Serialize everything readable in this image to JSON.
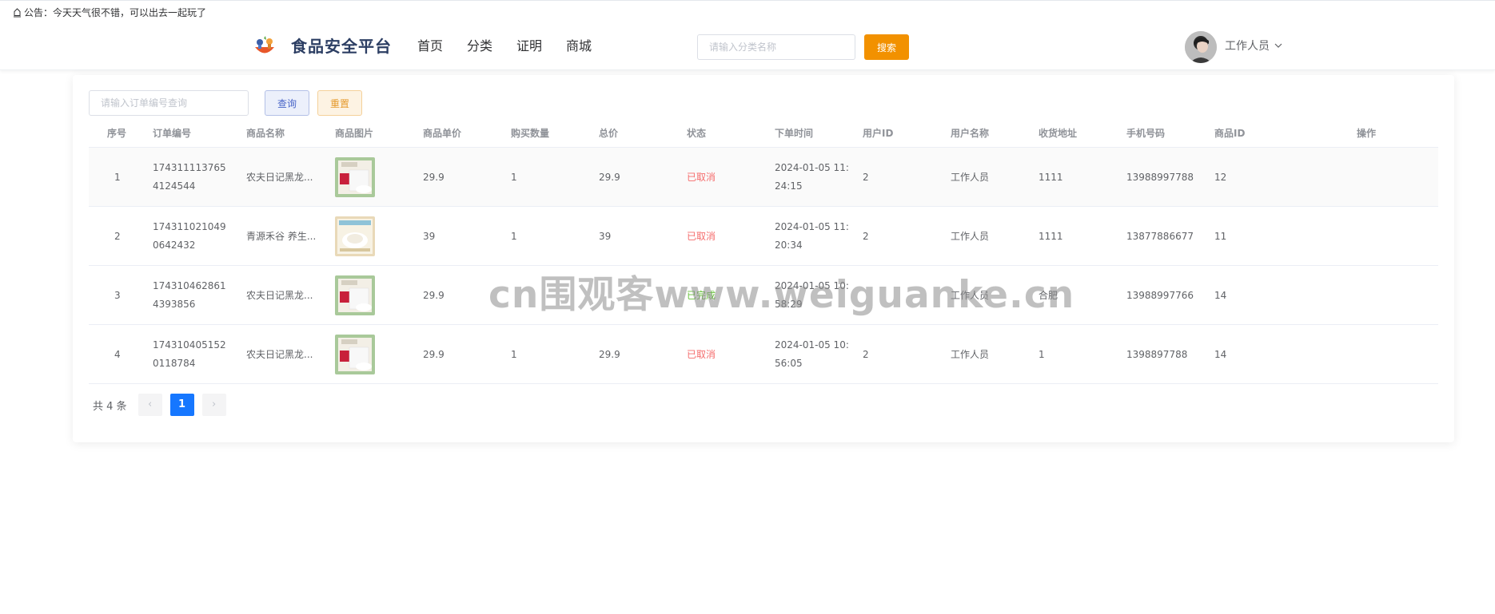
{
  "notice": {
    "text": "公告：今天天气很不错，可以出去一起玩了",
    "icon": "bell-icon"
  },
  "header": {
    "site_title": "食品安全平台",
    "nav": [
      "首页",
      "分类",
      "证明",
      "商城"
    ],
    "search": {
      "placeholder": "请输入分类名称",
      "value": "",
      "button": "搜索"
    },
    "user": {
      "name": "工作人员"
    }
  },
  "filter": {
    "order_placeholder": "请输入订单编号查询",
    "query_label": "查询",
    "reset_label": "重置"
  },
  "table": {
    "columns": [
      "序号",
      "订单编号",
      "商品名称",
      "商品图片",
      "商品单价",
      "购买数量",
      "总价",
      "状态",
      "下单时间",
      "用户ID",
      "用户名称",
      "收货地址",
      "手机号码",
      "商品ID",
      "操作"
    ],
    "rows": [
      {
        "index": "1",
        "order_no": "1743111137654124544",
        "product": "农夫日记黑龙...",
        "price": "29.9",
        "qty": "1",
        "total": "29.9",
        "status": "已取消",
        "time": "2024-01-05 11:24:15",
        "user_id": "2",
        "user_name": "工作人员",
        "address": "1111",
        "phone": "13988997788",
        "product_id": "12"
      },
      {
        "index": "2",
        "order_no": "1743110210490642432",
        "product": "青源禾谷 养生...",
        "price": "39",
        "qty": "1",
        "total": "39",
        "status": "已取消",
        "time": "2024-01-05 11:20:34",
        "user_id": "2",
        "user_name": "工作人员",
        "address": "1111",
        "phone": "13877886677",
        "product_id": "11"
      },
      {
        "index": "3",
        "order_no": "1743104628614393856",
        "product": "农夫日记黑龙...",
        "price": "29.9",
        "qty": "",
        "total": "",
        "status": "已完成",
        "time": "2024-01-05 10:58:29",
        "user_id": "",
        "user_name": "工作人员",
        "address": "合肥",
        "phone": "13988997766",
        "product_id": "14"
      },
      {
        "index": "4",
        "order_no": "1743104051520118784",
        "product": "农夫日记黑龙...",
        "price": "29.9",
        "qty": "1",
        "total": "29.9",
        "status": "已取消",
        "time": "2024-01-05 10:56:05",
        "user_id": "2",
        "user_name": "工作人员",
        "address": "1",
        "phone": "1398897788",
        "product_id": "14"
      }
    ]
  },
  "pagination": {
    "total_text": "共 4 条",
    "current_page": "1",
    "prev_icon": "chevron-left-icon",
    "next_icon": "chevron-right-icon"
  },
  "watermark": "cn围观客www.weiguanke.cn",
  "colors": {
    "accent": "#f29100",
    "page_active": "#1677ff",
    "status_cancelled": "#f56c6c",
    "status_done": "#67c23a",
    "title": "#2c3e63"
  }
}
